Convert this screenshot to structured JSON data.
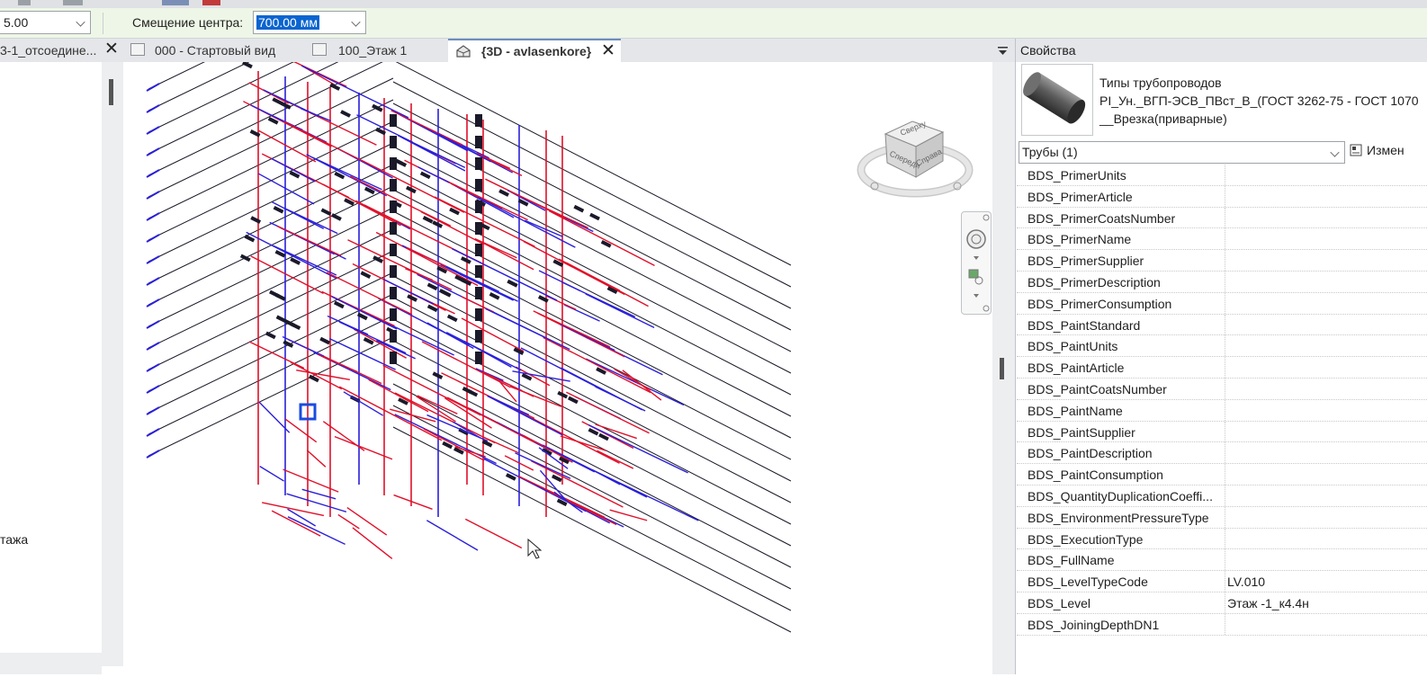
{
  "options_bar": {
    "left_value": "5.00",
    "offset_label": "Смещение центра:",
    "offset_value": "700.00 мм"
  },
  "left_panel": {
    "tab_label": "3-1_отсоедине...",
    "item_label": "тажа"
  },
  "view_tabs": [
    {
      "label": "000 - Стартовый вид",
      "active": false
    },
    {
      "label": "100_Этаж 1",
      "active": false
    },
    {
      "label": "{3D - avlasenkore}",
      "active": true
    }
  ],
  "viewcube": {
    "top_face": "Сверху",
    "front_face": "Спереди",
    "right_face": "Справа"
  },
  "properties": {
    "title": "Свойства",
    "type_name_line1": "Типы трубопроводов",
    "type_name_line2": "PI_Ун._ВГП-ЭСВ_ПВст_В_(ГОСТ 3262-75 - ГОСТ 1070",
    "type_name_line3": "__Врезка(приварные)",
    "filter_value": "Трубы (1)",
    "edit_type_label": "Измен",
    "rows": [
      {
        "key": "BDS_PrimerUnits",
        "value": ""
      },
      {
        "key": "BDS_PrimerArticle",
        "value": ""
      },
      {
        "key": "BDS_PrimerCoatsNumber",
        "value": ""
      },
      {
        "key": "BDS_PrimerName",
        "value": ""
      },
      {
        "key": "BDS_PrimerSupplier",
        "value": ""
      },
      {
        "key": "BDS_PrimerDescription",
        "value": ""
      },
      {
        "key": "BDS_PrimerConsumption",
        "value": ""
      },
      {
        "key": "BDS_PaintStandard",
        "value": ""
      },
      {
        "key": "BDS_PaintUnits",
        "value": ""
      },
      {
        "key": "BDS_PaintArticle",
        "value": ""
      },
      {
        "key": "BDS_PaintCoatsNumber",
        "value": ""
      },
      {
        "key": "BDS_PaintName",
        "value": ""
      },
      {
        "key": "BDS_PaintSupplier",
        "value": ""
      },
      {
        "key": "BDS_PaintDescription",
        "value": ""
      },
      {
        "key": "BDS_PaintConsumption",
        "value": ""
      },
      {
        "key": "BDS_QuantityDuplicationCoeffi...",
        "value": ""
      },
      {
        "key": "BDS_EnvironmentPressureType",
        "value": ""
      },
      {
        "key": "BDS_ExecutionType",
        "value": ""
      },
      {
        "key": "BDS_FullName",
        "value": ""
      },
      {
        "key": "BDS_LevelTypeCode",
        "value": "LV.010"
      },
      {
        "key": "BDS_Level",
        "value": "Этаж -1_к4.4н"
      },
      {
        "key": "BDS_JoiningDepthDN1",
        "value": ""
      }
    ]
  },
  "colors": {
    "options_bar_bg": "#eef6e7",
    "selection": "#0a64d0",
    "pipe_red": "#e0102a",
    "pipe_blue": "#2a20d8",
    "pipe_dark": "#1a1a2a"
  }
}
